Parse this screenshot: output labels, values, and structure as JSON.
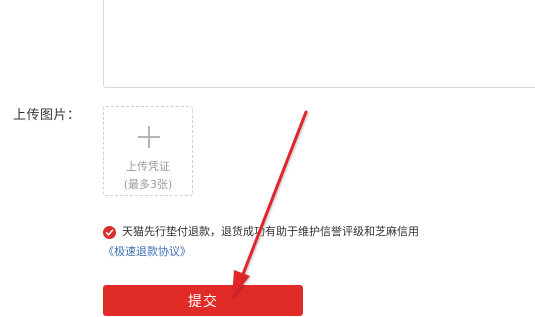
{
  "form": {
    "upload_label": "上传图片：",
    "upload_box": {
      "line1": "上传凭证",
      "line2": "(最多3张)"
    },
    "agreement": {
      "checked": true,
      "text": "天猫先行垫付退款，退货成功有助于维护信誉评级和芝麻信用",
      "link": "《极速退款协议》"
    },
    "submit_label": "提交"
  },
  "colors": {
    "accent_red": "#e02b27",
    "link_blue": "#3a6fb5",
    "annotation_arrow": "#e0262b"
  },
  "icons": {
    "upload": "plus-icon",
    "agree": "check-circle-icon",
    "annotation": "red-arrow-icon"
  }
}
